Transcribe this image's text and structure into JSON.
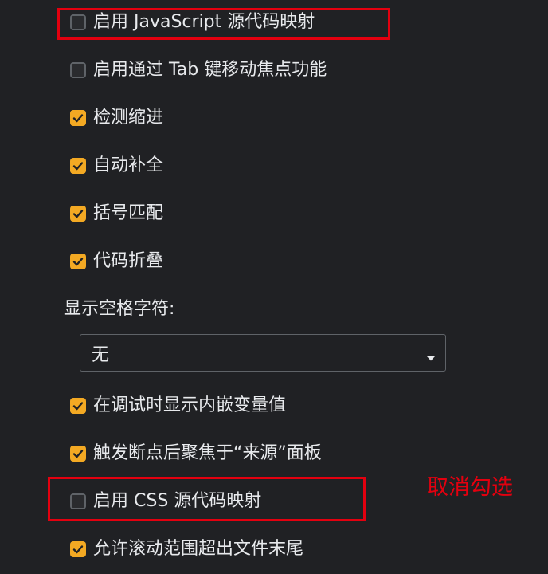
{
  "settings": {
    "items": [
      {
        "label": "启用 JavaScript 源代码映射",
        "checked": false
      },
      {
        "label": "启用通过 Tab 键移动焦点功能",
        "checked": false
      },
      {
        "label": "检测缩进",
        "checked": true
      },
      {
        "label": "自动补全",
        "checked": true
      },
      {
        "label": "括号匹配",
        "checked": true
      },
      {
        "label": "代码折叠",
        "checked": true
      },
      {
        "label": "在调试时显示内嵌变量值",
        "checked": true
      },
      {
        "label": "触发断点后聚焦于“来源”面板",
        "checked": true
      },
      {
        "label": "启用 CSS 源代码映射",
        "checked": false
      },
      {
        "label": "允许滚动范围超出文件末尾",
        "checked": true
      }
    ],
    "whitespace_label": "显示空格字符:",
    "whitespace_select_value": "无"
  },
  "annotation": {
    "text": "取消勾选",
    "color": "#e3000f"
  },
  "colors": {
    "background": "#202124",
    "checkbox_checked": "#f3a923",
    "text": "#e8eaed"
  }
}
